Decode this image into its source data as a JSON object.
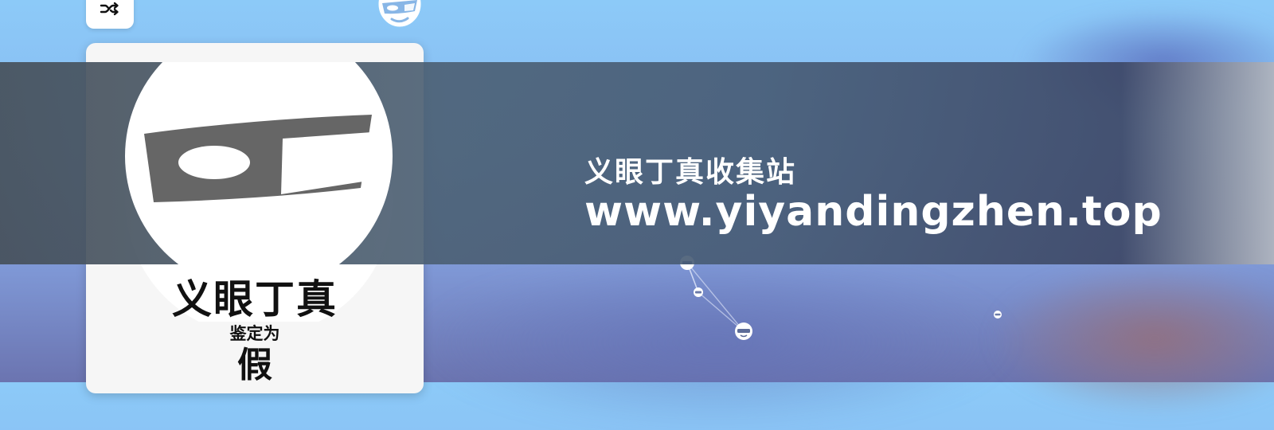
{
  "colors": {
    "sky_top": "#8ccaf8",
    "sky_bottom": "#6b74b0",
    "banner": "#4b5f73",
    "card_bg": "#f6f6f6",
    "mask_white": "#ffffff",
    "mask_band": "#6a6a6a"
  },
  "icons": {
    "shuffle": "shuffle-icon",
    "avatar": "mask-face-icon",
    "graph_node": "mask-face-icon"
  },
  "card": {
    "title": "义眼丁真",
    "subtitle": "鉴定为",
    "verdict": "假"
  },
  "banner": {
    "title": "义眼丁真收集站",
    "url": "www.yiyandingzhen.top"
  },
  "graph": {
    "node_count": 4
  }
}
